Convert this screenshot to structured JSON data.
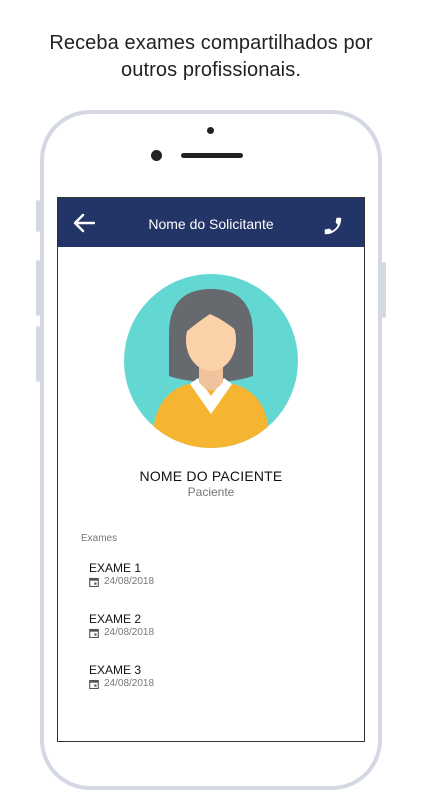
{
  "headline": {
    "line1": "Receba exames compartilhados por",
    "line2": "outros profissionais."
  },
  "appbar": {
    "title": "Nome do Solicitante",
    "color": "#233566"
  },
  "patient": {
    "name": "NOME DO PACIENTE",
    "role": "Paciente"
  },
  "exams_section": {
    "label": "Exames",
    "items": [
      {
        "name": "EXAME 1",
        "date": "24/08/2018"
      },
      {
        "name": "EXAME 2",
        "date": "24/08/2018"
      },
      {
        "name": "EXAME 3",
        "date": "24/08/2018"
      }
    ]
  },
  "icons": {
    "back": "arrow-left-icon",
    "call": "phone-icon",
    "date": "calendar-icon"
  },
  "colors": {
    "avatar_background": "#63d8d3",
    "avatar_shirt": "#f5b531"
  }
}
